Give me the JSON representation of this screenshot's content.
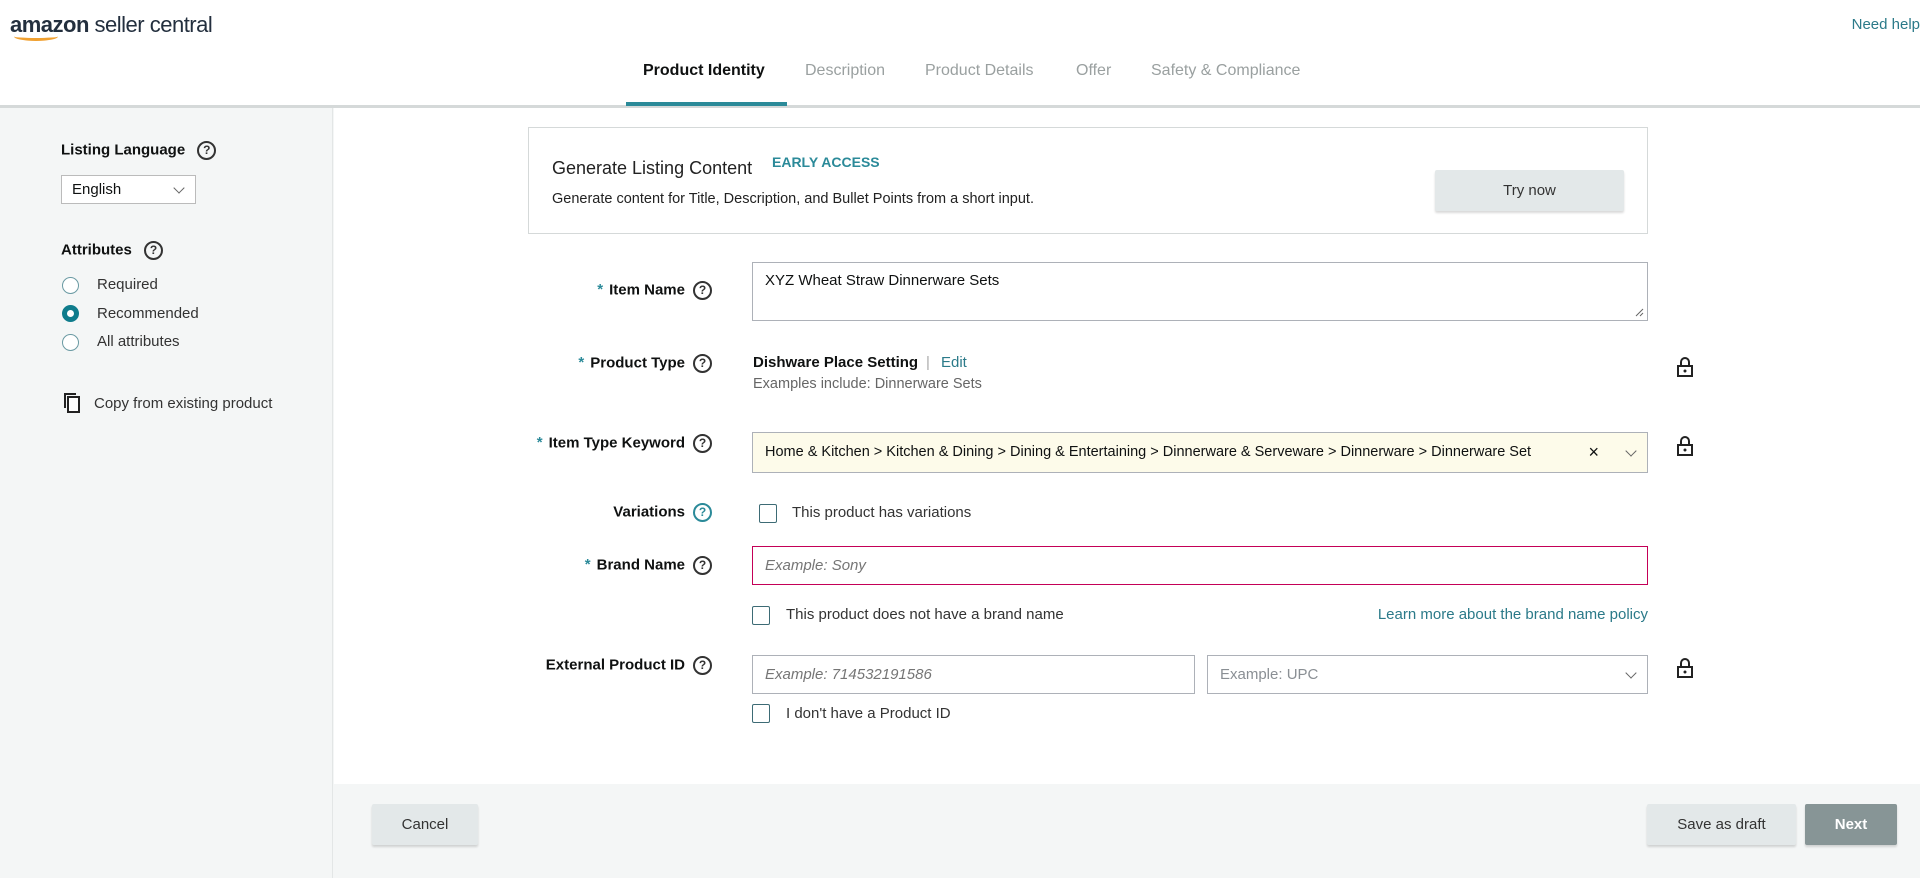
{
  "header": {
    "logo": "amazon seller central",
    "logo_bold": "amazon",
    "logo_rest": " seller central",
    "help_link": "Need help"
  },
  "tabs": [
    {
      "label": "Product Identity",
      "active": true
    },
    {
      "label": "Description"
    },
    {
      "label": "Product Details"
    },
    {
      "label": "Offer"
    },
    {
      "label": "Safety & Compliance"
    }
  ],
  "sidebar": {
    "listing_language_label": "Listing Language",
    "language_value": "English",
    "attributes_label": "Attributes",
    "attribute_options": [
      {
        "label": "Required",
        "selected": false
      },
      {
        "label": "Recommended",
        "selected": true
      },
      {
        "label": "All attributes",
        "selected": false
      }
    ],
    "copy_label": "Copy from existing product"
  },
  "promo": {
    "title": "Generate Listing Content",
    "badge": "EARLY ACCESS",
    "description": "Generate content for Title, Description, and Bullet Points from a short input.",
    "button": "Try now"
  },
  "form": {
    "item_name": {
      "label": "Item Name",
      "value": "XYZ Wheat Straw Dinnerware Sets"
    },
    "product_type": {
      "label": "Product Type",
      "value": "Dishware Place Setting",
      "separator": "|",
      "edit": "Edit",
      "examples": "Examples include: Dinnerware Sets"
    },
    "item_type_keyword": {
      "label": "Item Type Keyword",
      "value": "Home & Kitchen > Kitchen & Dining > Dining & Entertaining > Dinnerware & Serveware > Dinnerware > Dinnerware Set",
      "clear": "×"
    },
    "variations": {
      "label": "Variations",
      "checkbox": "This product has variations"
    },
    "brand_name": {
      "label": "Brand Name",
      "placeholder": "Example: Sony",
      "no_brand": "This product does not have a brand name",
      "policy_link": "Learn more about the brand name policy"
    },
    "external_id": {
      "label": "External Product ID",
      "placeholder": "Example: 714532191586",
      "type_placeholder": "Example: UPC",
      "no_id": "I don't have a Product ID"
    },
    "required_marker": "*",
    "help_glyph": "?"
  },
  "footer": {
    "cancel": "Cancel",
    "save_draft": "Save as draft",
    "next": "Next"
  },
  "colors": {
    "accent": "#2b8a99",
    "error_border": "#c40057",
    "keyword_bg": "#fdfbea",
    "next_bg": "#879596"
  }
}
